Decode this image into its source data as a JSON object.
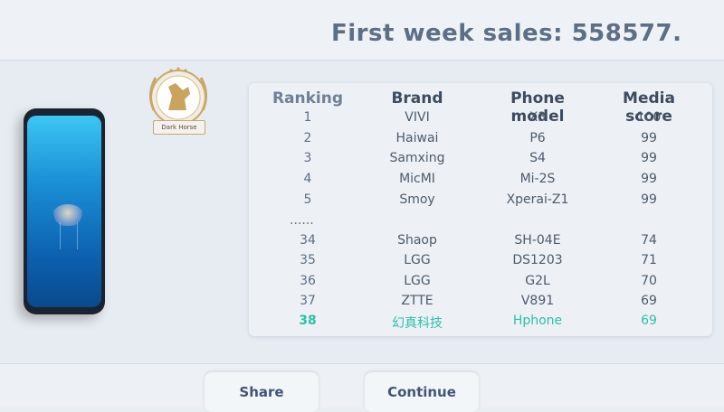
{
  "header": {
    "title": "First week sales: 558577."
  },
  "badge": {
    "label": "Dark Horse",
    "icon": "horse-laurel-icon"
  },
  "table": {
    "headers": [
      "Ranking",
      "Brand",
      "Phone model",
      "Media score"
    ],
    "rows": [
      {
        "rank": "1",
        "brand": "VIVI",
        "model": "X3",
        "score": "100"
      },
      {
        "rank": "2",
        "brand": "Haiwai",
        "model": "P6",
        "score": "99"
      },
      {
        "rank": "3",
        "brand": "Samxing",
        "model": "S4",
        "score": "99"
      },
      {
        "rank": "4",
        "brand": "MicMI",
        "model": "Mi-2S",
        "score": "99"
      },
      {
        "rank": "5",
        "brand": "Smoy",
        "model": "Xperai-Z1",
        "score": "99"
      },
      {
        "rank": "......",
        "brand": "",
        "model": "",
        "score": ""
      },
      {
        "rank": "34",
        "brand": "Shaop",
        "model": "SH-04E",
        "score": "74"
      },
      {
        "rank": "35",
        "brand": "LGG",
        "model": "DS1203",
        "score": "71"
      },
      {
        "rank": "36",
        "brand": "LGG",
        "model": "G2L",
        "score": "70"
      },
      {
        "rank": "37",
        "brand": "ZTTE",
        "model": "V891",
        "score": "69"
      },
      {
        "rank": "38",
        "brand": "幻真科技",
        "model": "Hphone",
        "score": "69"
      }
    ],
    "highlight_color": "#2fbfa8"
  },
  "buttons": {
    "share": "Share",
    "continue": "Continue"
  }
}
